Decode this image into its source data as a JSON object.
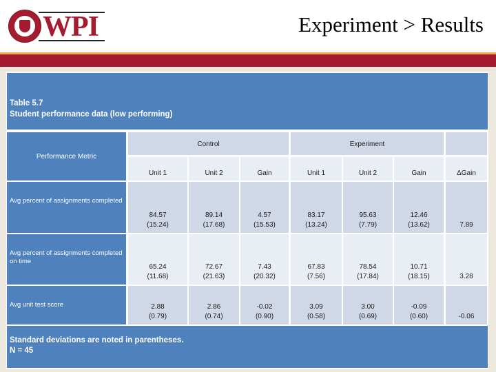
{
  "header": {
    "logo_text": "WPI",
    "slide_title": "Experiment > Results",
    "colors": {
      "brand_red": "#a51c30",
      "accent_orange": "#f4a55a",
      "table_blue": "#4f81bd"
    }
  },
  "table": {
    "title_line1": "Table 5.7",
    "title_line2": "Student performance data (low performing)",
    "metric_header": "Performance Metric",
    "groups": {
      "control": "Control",
      "experiment": "Experiment"
    },
    "subheaders": [
      "Unit 1",
      "Unit 2",
      "Gain",
      "Unit 1",
      "Unit 2",
      "Gain",
      "ΔGain"
    ],
    "rows": [
      {
        "metric": "Avg percent of assignments completed",
        "values": [
          {
            "mean": "84.57",
            "sd": "(15.24)"
          },
          {
            "mean": "89.14",
            "sd": "(17.68)"
          },
          {
            "mean": "4.57",
            "sd": "(15.53)"
          },
          {
            "mean": "83.17",
            "sd": "(13.24)"
          },
          {
            "mean": "95.63",
            "sd": "(7.79)"
          },
          {
            "mean": "12.46",
            "sd": "(13.62)"
          },
          {
            "mean": "7.89",
            "sd": ""
          }
        ]
      },
      {
        "metric": "Avg percent of assignments completed on time",
        "values": [
          {
            "mean": "65.24",
            "sd": "(11.68)"
          },
          {
            "mean": "72.67",
            "sd": "(21.63)"
          },
          {
            "mean": "7.43",
            "sd": "(20.32)"
          },
          {
            "mean": "67.83",
            "sd": "(7.56)"
          },
          {
            "mean": "78.54",
            "sd": "(17.84)"
          },
          {
            "mean": "10.71",
            "sd": "(18.15)"
          },
          {
            "mean": "3.28",
            "sd": ""
          }
        ]
      },
      {
        "metric": "Avg unit test score",
        "values": [
          {
            "mean": "2.88",
            "sd": "(0.79)"
          },
          {
            "mean": "2.86",
            "sd": "(0.74)"
          },
          {
            "mean": "-0.02",
            "sd": "(0.90)"
          },
          {
            "mean": "3.09",
            "sd": "(0.58)"
          },
          {
            "mean": "3.00",
            "sd": "(0.69)"
          },
          {
            "mean": "-0.09",
            "sd": "(0.60)"
          },
          {
            "mean": "-0.06",
            "sd": ""
          }
        ]
      }
    ],
    "footer_line1": "Standard deviations are noted in parentheses.",
    "footer_line2": "N = 45"
  }
}
